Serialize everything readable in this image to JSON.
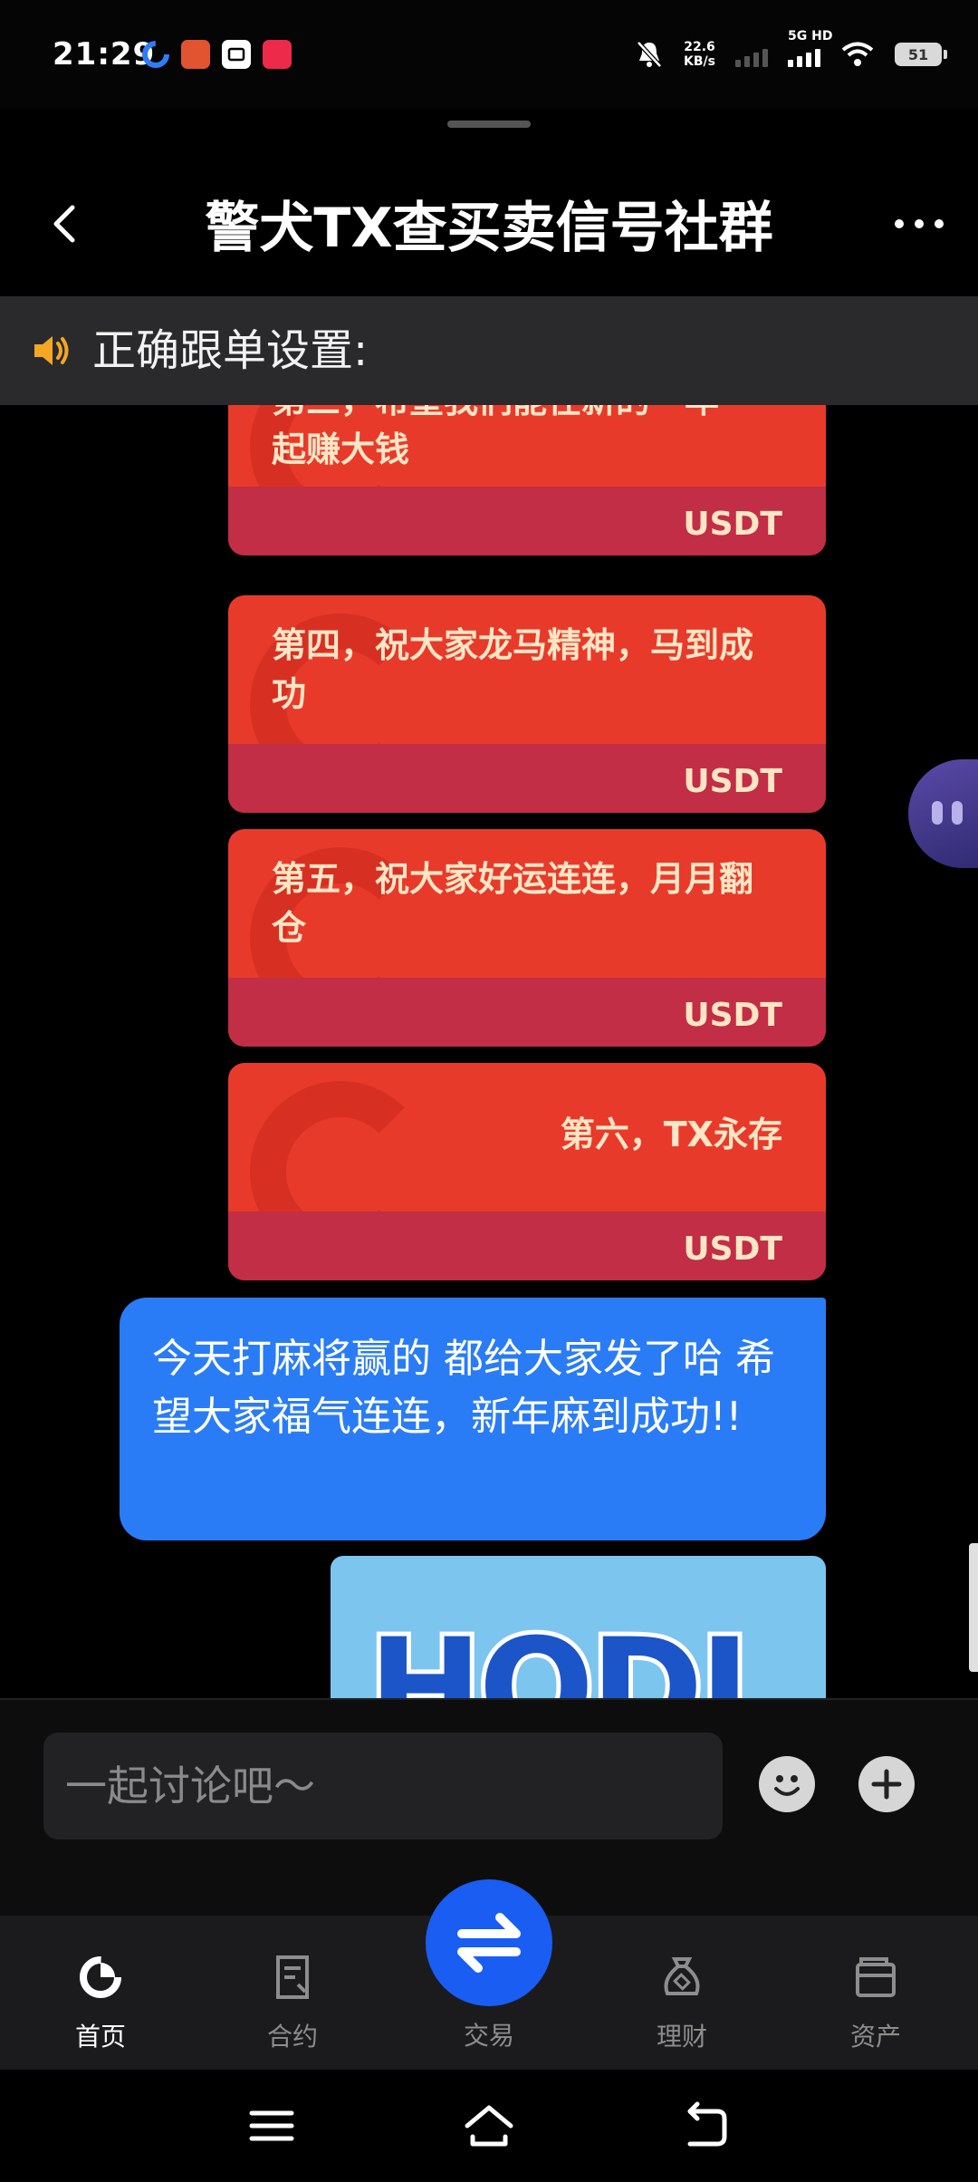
{
  "status_bar": {
    "time": "21:29",
    "net_speed_value": "22.6",
    "net_speed_unit": "KB/s",
    "network_label": "5G HD",
    "battery": "51"
  },
  "header": {
    "title": "警犬TX查买卖信号社群"
  },
  "announcement": {
    "text": "正确跟单设置:"
  },
  "messages": {
    "red_packets": [
      {
        "text": "第三，希望我们能在新的一年一起赚大钱",
        "coin": "USDT"
      },
      {
        "text": "第四，祝大家龙马精神，马到成功",
        "coin": "USDT"
      },
      {
        "text": "第五，祝大家好运连连，月月翻仓",
        "coin": "USDT"
      },
      {
        "text": "第六，TX永存",
        "coin": "USDT"
      }
    ],
    "text_bubble": "今天打麻将赢的 都给大家发了哈 希望大家福气连连，新年麻到成功!!",
    "image_text": "HODL"
  },
  "input": {
    "placeholder": "一起讨论吧～"
  },
  "nav": {
    "items": [
      {
        "label": "首页"
      },
      {
        "label": "合约"
      },
      {
        "label": "交易"
      },
      {
        "label": "理财"
      },
      {
        "label": "资产"
      }
    ]
  },
  "colors": {
    "accent": "#1a5df2",
    "bubble": "#2a7cf6",
    "red_packet": "#e83a2b",
    "red_packet_bottom": "#c12e45",
    "speaker": "#f5a623"
  }
}
